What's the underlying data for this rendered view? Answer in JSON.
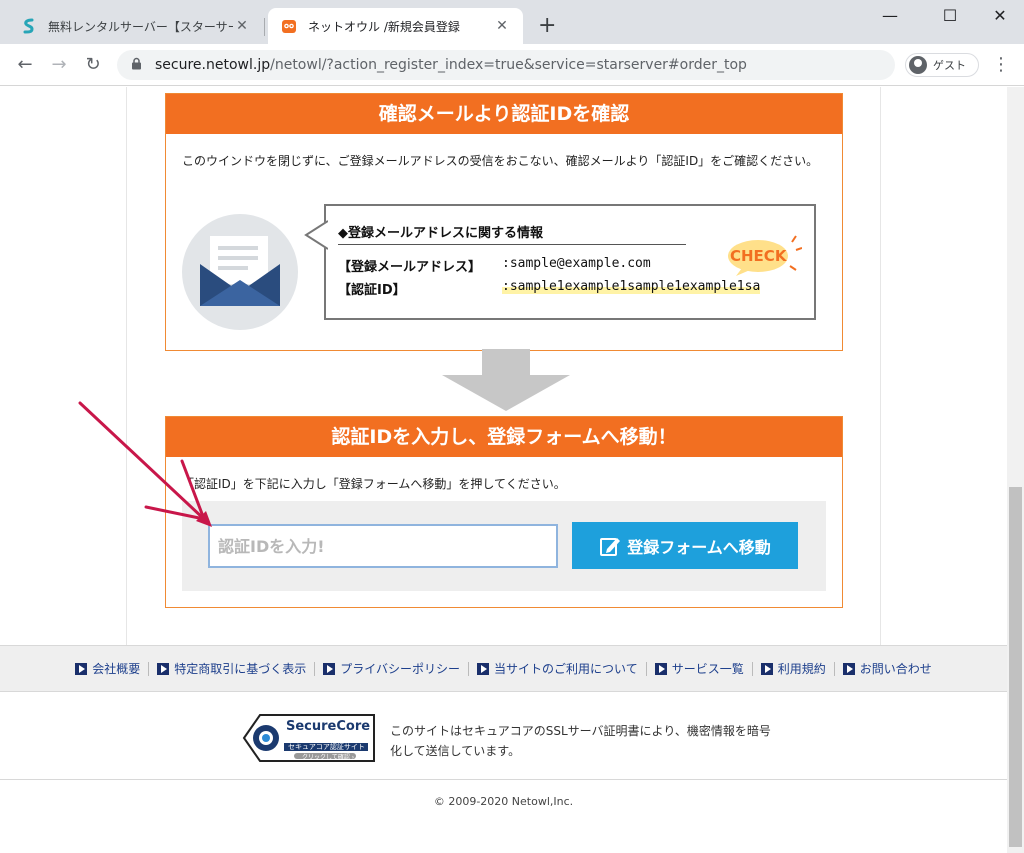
{
  "tabs": [
    {
      "title": "無料レンタルサーバー【スターサーバーフリー】",
      "close": "✕"
    },
    {
      "title": "ネットオウル /新規会員登録",
      "close": "✕"
    }
  ],
  "newtab": "+",
  "window": {
    "minimize": "—",
    "maximize": "☐",
    "close": "✕"
  },
  "address": {
    "host": "secure.netowl.jp",
    "path": "/netowl/?action_register_index=true&service=starserver#order_top"
  },
  "profile": {
    "label": "ゲスト"
  },
  "section1": {
    "heading": "確認メールより認証IDを確認",
    "description": "このウインドウを閉じずに、ご登録メールアドレスの受信をおこない、確認メールより「認証ID」をご確認ください。",
    "info_title": "◆登録メールアドレスに関する情報",
    "email_label": "【登録メールアドレス】",
    "email_value": ":sample@example.com",
    "id_label": "【認証ID】",
    "id_value": ":sample1example1sample1example1sa",
    "check": "CHECK"
  },
  "section2": {
    "heading": "認証IDを入力し、登録フォームへ移動！",
    "description": "「認証ID」を下記に入力し「登録フォームへ移動」を押してください。",
    "input_placeholder": "認証IDを入力!",
    "button_label": "登録フォームへ移動"
  },
  "footer_links": [
    "会社概要",
    "特定商取引に基づく表示",
    "プライバシーポリシー",
    "当サイトのご利用について",
    "サービス一覧",
    "利用規約",
    "お問い合わせ"
  ],
  "securecore": {
    "brand": "SecureCore",
    "sub": "セキュアコア認証サイト",
    "click": "クリックして確認 ›",
    "text": "このサイトはセキュアコアのSSLサーバ証明書により、機密情報を暗号化して送信しています。"
  },
  "copyright": "© 2009-2020 Netowl,Inc.",
  "colors": {
    "accent": "#f26f21",
    "button": "#1ea0dc",
    "arrow": "#c8174a"
  }
}
